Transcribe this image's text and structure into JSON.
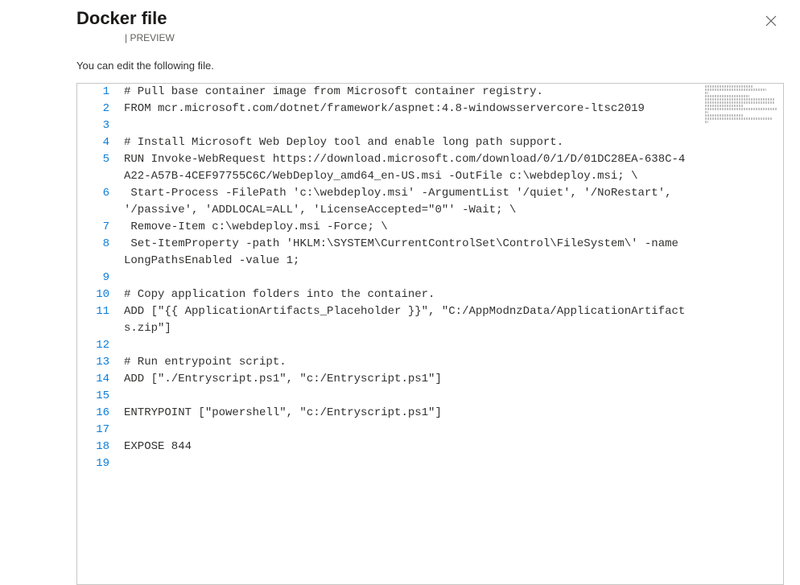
{
  "title": "Docker file",
  "preview_sep": "| ",
  "preview_label": "PREVIEW",
  "instruction": "You can edit the following file.",
  "code_lines": [
    {
      "n": "1",
      "t": "# Pull base container image from Microsoft container registry."
    },
    {
      "n": "2",
      "t": "FROM mcr.microsoft.com/dotnet/framework/aspnet:4.8-windowsservercore-ltsc2019"
    },
    {
      "n": "3",
      "t": ""
    },
    {
      "n": "4",
      "t": "# Install Microsoft Web Deploy tool and enable long path support."
    },
    {
      "n": "5",
      "t": "RUN Invoke-WebRequest https://download.microsoft.com/download/0/1/D/01DC28EA-638C-4A22-A57B-4CEF97755C6C/WebDeploy_amd64_en-US.msi -OutFile c:\\webdeploy.msi; \\"
    },
    {
      "n": "6",
      "t": " Start-Process -FilePath 'c:\\webdeploy.msi' -ArgumentList '/quiet', '/NoRestart', '/passive', 'ADDLOCAL=ALL', 'LicenseAccepted=\"0\"' -Wait; \\"
    },
    {
      "n": "7",
      "t": " Remove-Item c:\\webdeploy.msi -Force; \\"
    },
    {
      "n": "8",
      "t": " Set-ItemProperty -path 'HKLM:\\SYSTEM\\CurrentControlSet\\Control\\FileSystem\\' -name LongPathsEnabled -value 1;"
    },
    {
      "n": "9",
      "t": ""
    },
    {
      "n": "10",
      "t": "# Copy application folders into the container."
    },
    {
      "n": "11",
      "t": "ADD [\"{{ ApplicationArtifacts_Placeholder }}\", \"C:/AppModnzData/ApplicationArtifacts.zip\"]"
    },
    {
      "n": "12",
      "t": ""
    },
    {
      "n": "13",
      "t": "# Run entrypoint script."
    },
    {
      "n": "14",
      "t": "ADD [\"./Entryscript.ps1\", \"c:/Entryscript.ps1\"]"
    },
    {
      "n": "15",
      "t": ""
    },
    {
      "n": "16",
      "t": "ENTRYPOINT [\"powershell\", \"c:/Entryscript.ps1\"]"
    },
    {
      "n": "17",
      "t": ""
    },
    {
      "n": "18",
      "t": "EXPOSE 844"
    },
    {
      "n": "19",
      "t": ""
    }
  ],
  "minimap_widths": [
    62,
    80,
    4,
    58,
    90,
    92,
    50,
    94,
    4,
    50,
    88,
    4,
    30,
    52,
    4,
    60,
    4,
    24,
    4
  ]
}
